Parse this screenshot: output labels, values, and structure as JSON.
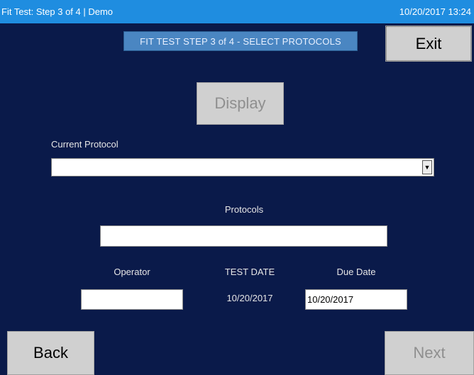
{
  "titlebar": {
    "title": "Fit Test: Step 3 of 4 | Demo",
    "datetime": "10/20/2017 13:24"
  },
  "banner": {
    "text": "FIT TEST STEP 3 of 4 - SELECT PROTOCOLS"
  },
  "buttons": {
    "exit": "Exit",
    "display": "Display",
    "back": "Back",
    "next": "Next"
  },
  "form": {
    "current_protocol_label": "Current Protocol",
    "current_protocol_value": "",
    "protocols_label": "Protocols",
    "protocols_value": "",
    "operator_label": "Operator",
    "operator_value": "",
    "test_date_label": "TEST DATE",
    "test_date_value": "10/20/2017",
    "due_date_label": "Due Date",
    "due_date_value": "10/20/2017"
  },
  "icons": {
    "select_arrow": "chevron-down-icon"
  },
  "colors": {
    "background": "#0a1a4a",
    "titlebar": "#1f8de0",
    "banner": "#4a86c2",
    "button": "#d0d0d0",
    "disabled_text": "#8f8f8f"
  }
}
